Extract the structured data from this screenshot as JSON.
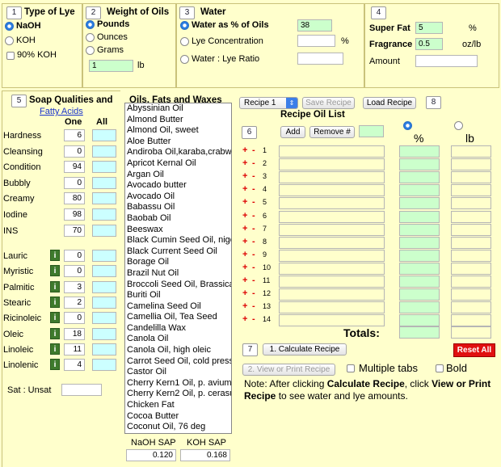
{
  "lye_type": {
    "step": "1",
    "title": "Type of Lye",
    "opt_naoh": "NaOH",
    "opt_koh": "KOH",
    "opt_90koh": "90% KOH"
  },
  "weight": {
    "step": "2",
    "title": "Weight of Oils",
    "opt_pounds": "Pounds",
    "opt_ounces": "Ounces",
    "opt_grams": "Grams",
    "value": "1",
    "unit": "lb"
  },
  "water": {
    "step": "3",
    "title": "Water",
    "opt_pct": "Water as % of Oils",
    "pct_value": "38",
    "opt_conc": "Lye Concentration",
    "conc_unit": "%",
    "opt_ratio": "Water : Lye Ratio"
  },
  "extras": {
    "step": "4",
    "superfat_label": "Super Fat",
    "superfat_value": "5",
    "superfat_unit": "%",
    "fragrance_label": "Fragrance",
    "fragrance_value": "0.5",
    "fragrance_unit": "oz/lb",
    "amount_label": "Amount"
  },
  "qualities": {
    "step": "5",
    "title": "Soap Qualities and",
    "link": "Fatty Acids",
    "col_one": "One",
    "col_all": "All",
    "rows": [
      {
        "label": "Hardness",
        "one": "6"
      },
      {
        "label": "Cleansing",
        "one": "0"
      },
      {
        "label": "Condition",
        "one": "94"
      },
      {
        "label": "Bubbly",
        "one": "0"
      },
      {
        "label": "Creamy",
        "one": "80"
      },
      {
        "label": "Iodine",
        "one": "98"
      },
      {
        "label": "INS",
        "one": "70"
      }
    ],
    "acids": [
      {
        "label": "Lauric",
        "one": "0"
      },
      {
        "label": "Myristic",
        "one": "0"
      },
      {
        "label": "Palmitic",
        "one": "3"
      },
      {
        "label": "Stearic",
        "one": "2"
      },
      {
        "label": "Ricinoleic",
        "one": "0"
      },
      {
        "label": "Oleic",
        "one": "18"
      },
      {
        "label": "Linoleic",
        "one": "11"
      },
      {
        "label": "Linolenic",
        "one": "4"
      }
    ],
    "info_glyph": "i",
    "satunsat_label": "Sat : Unsat"
  },
  "oils": {
    "title": "Oils, Fats and Waxes",
    "items": [
      "Abyssinian Oil",
      "Almond Butter",
      "Almond Oil, sweet",
      "Aloe Butter",
      "Andiroba Oil,karaba,crabwo",
      "Apricot Kernal Oil",
      "Argan Oil",
      "Avocado butter",
      "Avocado Oil",
      "Babassu Oil",
      "Baobab Oil",
      "Beeswax",
      "Black Cumin Seed Oil, nigell",
      "Black Current Seed Oil",
      "Borage Oil",
      "Brazil Nut Oil",
      "Broccoli Seed Oil, Brassica O",
      "Buriti Oil",
      "Camelina Seed Oil",
      "Camellia Oil, Tea Seed",
      "Candelilla Wax",
      "Canola Oil",
      "Canola Oil, high oleic",
      "Carrot Seed Oil, cold presse",
      "Castor Oil",
      "Cherry Kern1 Oil, p. avium",
      "Cherry Kern2 Oil, p. cerasus",
      "Chicken Fat",
      "Cocoa Butter",
      "Coconut Oil, 76 deg"
    ],
    "naoh_sap_label": "NaOH SAP",
    "koh_sap_label": "KOH SAP",
    "naoh_sap": "0.120",
    "koh_sap": "0.168"
  },
  "recipe": {
    "select": "Recipe 1",
    "save": "Save Recipe",
    "load": "Load Recipe",
    "step8": "8",
    "title": "Recipe Oil List",
    "step6": "6",
    "add": "Add",
    "remove": "Remove #",
    "col_pct": "%",
    "col_lb": "lb",
    "rows": [
      "1",
      "2",
      "3",
      "4",
      "5",
      "6",
      "7",
      "8",
      "9",
      "10",
      "11",
      "12",
      "13",
      "14"
    ],
    "plus": "+",
    "minus": "-",
    "totals": "Totals:",
    "step7": "7",
    "calc": "1. Calculate Recipe",
    "reset": "Reset All",
    "view": "2. View or Print Recipe",
    "multi_tabs": "Multiple tabs",
    "bold": "Bold",
    "note_a": "Note: After clicking ",
    "note_b": "Calculate Recipe",
    "note_c": ", click ",
    "note_d": "View or Print Recipe",
    "note_e": " to see water and lye amounts."
  }
}
